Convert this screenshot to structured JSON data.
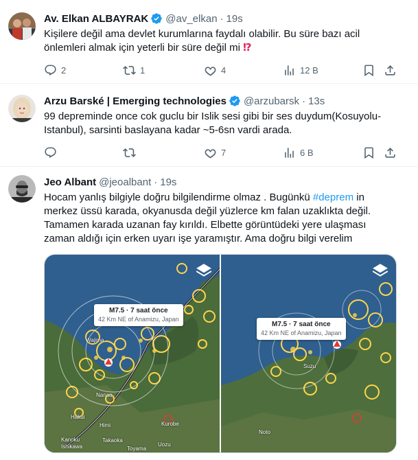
{
  "tweets": [
    {
      "name": "Av. Elkan ALBAYRAK",
      "handle": "@av_elkan",
      "separator": "·",
      "time": "19s",
      "text_lines": [
        "Kişilere değil ama devlet kurumlarına faydalı olabilir. Bu süre bazı acil",
        "önlemleri almak için yeterli bir süre değil mi"
      ],
      "emoji": "⁉",
      "replies": "2",
      "reposts": "1",
      "likes": "4",
      "views": "12 B"
    },
    {
      "name": "Arzu Barské | Emerging technologies",
      "handle": "@arzubarsk",
      "separator": "·",
      "time": "13s",
      "text_lines": [
        "99 depreminde once cok guclu bir Islik sesi gibi bir ses duydum(Kosuyolu-",
        "Istanbul), sarsinti baslayana kadar ~5-6sn vardi arada."
      ],
      "replies": "",
      "reposts": "",
      "likes": "7",
      "views": "6 B"
    },
    {
      "name": "Jeo Albant",
      "handle": "@jeoalbant",
      "separator": "·",
      "time": "19s",
      "text_line1_before": "Hocam yanlış bilgiyle doğru bilgilendirme olmaz . Bugünkü ",
      "hashtag": "#deprem",
      "text_line1_after": " in",
      "text_lines_rest": [
        "merkez üssü karada, okyanusda değil yüzlerce km falan uzaklıkta değil.",
        "Tamamen karada uzanan fay kırıldı. Elbette görüntüdeki yere ulaşması",
        "zaman aldığı için erken uyarı işe yaramıştır. Ama doğru bilgi verelim"
      ],
      "media": {
        "left_card": {
          "magnitude": "M7.5 · 7 saat önce",
          "location": "42 Km NE of Anamizu, Japan"
        },
        "right_card": {
          "magnitude": "M7.5 · 7 saat önce",
          "location": "42 Km NE of Anamizu, Japan"
        },
        "left_labels": [
          "Wajima",
          "Nanao",
          "Hakui",
          "Himi",
          "Kanoku",
          "Ishikawa",
          "Takaoka",
          "Kurobe",
          "Uozu",
          "Toyama"
        ],
        "right_labels": [
          "Suzu",
          "Noto"
        ]
      }
    }
  ],
  "colors": {
    "text": "#0f1419",
    "muted": "#536471",
    "link": "#1d9bf0",
    "verified": "#1d9bf0",
    "divider": "#eff3f4"
  }
}
